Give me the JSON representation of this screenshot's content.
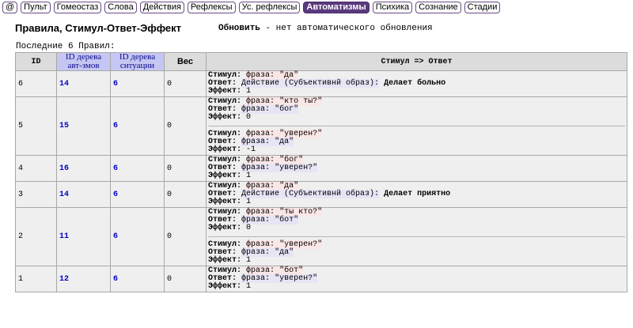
{
  "nav": [
    {
      "label": "@",
      "active": false
    },
    {
      "label": "Пульт",
      "active": false
    },
    {
      "label": "Гомеостаз",
      "active": false
    },
    {
      "label": "Слова",
      "active": false
    },
    {
      "label": "Действия",
      "active": false
    },
    {
      "label": "Рефлексы",
      "active": false
    },
    {
      "label": "Ус. рефлексы",
      "active": false
    },
    {
      "label": "Автоматизмы",
      "active": true
    },
    {
      "label": "Психика",
      "active": false
    },
    {
      "label": "Сознание",
      "active": false
    },
    {
      "label": "Стадии",
      "active": false
    }
  ],
  "page": {
    "title": "Правила, Стимул-Ответ-Эффект",
    "refresh_link": "Обновить",
    "refresh_note": " - нет автоматического обновления",
    "count_text": "Последние 6 Правил:"
  },
  "table": {
    "headers": {
      "id": "ID",
      "tree_auto": "ID дерева авт-змов",
      "tree_situation": "ID дерева ситуации",
      "weight": "Вес",
      "stimulus_response": "Стимул => Ответ"
    },
    "labels": {
      "stimulus": "Стимул:",
      "response": "Ответ:",
      "effect": "Эффект:"
    },
    "rows": [
      {
        "id": "6",
        "tree_auto": "14",
        "tree_situation": "6",
        "weight": "0",
        "entries": [
          {
            "stimulus_kind": "фраза:",
            "stimulus_value": "\"да\"",
            "response_kind": "Действие (Субъективнй образ):",
            "response_value": "Делает больно",
            "effect": "1"
          }
        ]
      },
      {
        "id": "5",
        "tree_auto": "15",
        "tree_situation": "6",
        "weight": "0",
        "entries": [
          {
            "stimulus_kind": "фраза:",
            "stimulus_value": "\"кто ты?\"",
            "response_kind": "фраза:",
            "response_value": "\"бог\"",
            "effect": "0"
          },
          {
            "stimulus_kind": "фраза:",
            "stimulus_value": "\"уверен?\"",
            "response_kind": "фраза:",
            "response_value": "\"да\"",
            "effect": "-1"
          }
        ]
      },
      {
        "id": "4",
        "tree_auto": "16",
        "tree_situation": "6",
        "weight": "0",
        "entries": [
          {
            "stimulus_kind": "фраза:",
            "stimulus_value": "\"бог\"",
            "response_kind": "фраза:",
            "response_value": "\"уверен?\"",
            "effect": "1"
          }
        ]
      },
      {
        "id": "3",
        "tree_auto": "14",
        "tree_situation": "6",
        "weight": "0",
        "entries": [
          {
            "stimulus_kind": "фраза:",
            "stimulus_value": "\"да\"",
            "response_kind": "Действие (Субъективнй образ):",
            "response_value": "Делает приятно",
            "effect": "1"
          }
        ]
      },
      {
        "id": "2",
        "tree_auto": "11",
        "tree_situation": "6",
        "weight": "0",
        "entries": [
          {
            "stimulus_kind": "фраза:",
            "stimulus_value": "\"ты кто?\"",
            "response_kind": "фраза:",
            "response_value": "\"бот\"",
            "effect": "0"
          },
          {
            "stimulus_kind": "фраза:",
            "stimulus_value": "\"уверен?\"",
            "response_kind": "фраза:",
            "response_value": "\"да\"",
            "effect": "1"
          }
        ]
      },
      {
        "id": "1",
        "tree_auto": "12",
        "tree_situation": "6",
        "weight": "0",
        "entries": [
          {
            "stimulus_kind": "фраза:",
            "stimulus_value": "\"бот\"",
            "response_kind": "фраза:",
            "response_value": "\"уверен?\"",
            "effect": "1"
          }
        ]
      }
    ]
  }
}
